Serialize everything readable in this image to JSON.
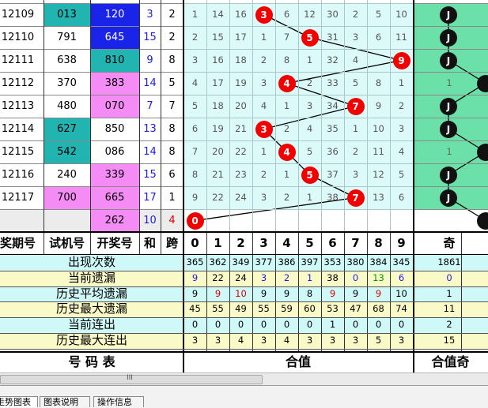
{
  "colors": {
    "period_bg": "#ffffff",
    "trial_teal": "#22b4b0",
    "trial_magenta": "#f58cf5",
    "draw_blue": "#1a24e8",
    "draw_teal": "#22b4b0",
    "draw_magenta": "#f58cf5",
    "chart_bg": "#ddfafa",
    "green_band": "#6be0a8",
    "pending_bg": "#ececec",
    "ball_red": "#f20000",
    "stat_cyan": "#cff8f8",
    "stat_yellow": "#fafac8",
    "stat_blue_text": "#1e1edc",
    "stat_red_text": "#e00000",
    "stat_green_text": "#009900"
  },
  "rows": [
    {
      "period": "12109",
      "trial": "013",
      "trial_color": "teal",
      "draw": "120",
      "draw_color": "blue",
      "sum": "3",
      "span": "2",
      "miss": [
        "1",
        "14",
        "16",
        "",
        "6",
        "12",
        "30",
        "2",
        "5",
        "10"
      ],
      "ball": 3,
      "odd": "J"
    },
    {
      "period": "12110",
      "trial": "791",
      "trial_color": "",
      "draw": "645",
      "draw_color": "blue",
      "sum": "15",
      "span": "2",
      "miss": [
        "2",
        "15",
        "17",
        "1",
        "7",
        "",
        "31",
        "3",
        "6",
        "11"
      ],
      "ball": 5,
      "odd": "J"
    },
    {
      "period": "12111",
      "trial": "638",
      "trial_color": "",
      "draw": "810",
      "draw_color": "teal",
      "sum": "9",
      "span": "8",
      "miss": [
        "3",
        "16",
        "18",
        "2",
        "8",
        "1",
        "32",
        "4",
        "",
        "12"
      ],
      "ball": 9,
      "odd": "J"
    },
    {
      "period": "12112",
      "trial": "370",
      "trial_color": "",
      "draw": "383",
      "draw_color": "magenta",
      "sum": "14",
      "span": "5",
      "miss": [
        "4",
        "17",
        "19",
        "3",
        "",
        "2",
        "33",
        "5",
        "8",
        "1"
      ],
      "ball": 4,
      "odd": "1"
    },
    {
      "period": "12113",
      "trial": "480",
      "trial_color": "",
      "draw": "070",
      "draw_color": "magenta",
      "sum": "7",
      "span": "7",
      "miss": [
        "5",
        "18",
        "20",
        "4",
        "1",
        "3",
        "34",
        "",
        "9",
        "2"
      ],
      "ball": 7,
      "odd": "J"
    },
    {
      "period": "12114",
      "trial": "627",
      "trial_color": "teal",
      "draw": "850",
      "draw_color": "",
      "sum": "13",
      "span": "8",
      "miss": [
        "6",
        "19",
        "21",
        "",
        "2",
        "4",
        "35",
        "1",
        "10",
        "3"
      ],
      "ball": 3,
      "odd": "J"
    },
    {
      "period": "12115",
      "trial": "542",
      "trial_color": "teal",
      "draw": "086",
      "draw_color": "",
      "sum": "14",
      "span": "8",
      "miss": [
        "7",
        "20",
        "22",
        "1",
        "",
        "5",
        "36",
        "2",
        "11",
        "4"
      ],
      "ball": 4,
      "odd": "1"
    },
    {
      "period": "12116",
      "trial": "240",
      "trial_color": "",
      "draw": "339",
      "draw_color": "magenta",
      "sum": "15",
      "span": "6",
      "miss": [
        "8",
        "21",
        "23",
        "2",
        "1",
        "",
        "37",
        "3",
        "12",
        "5"
      ],
      "ball": 5,
      "odd": "J"
    },
    {
      "period": "12117",
      "trial": "700",
      "trial_color": "magenta",
      "draw": "665",
      "draw_color": "magenta",
      "sum": "17",
      "span": "1",
      "miss": [
        "9",
        "22",
        "24",
        "3",
        "2",
        "1",
        "38",
        "",
        "13",
        "6"
      ],
      "ball": 7,
      "odd": "J"
    },
    {
      "period": "",
      "trial": "",
      "trial_color": "",
      "draw": "262",
      "draw_color": "magenta",
      "sum": "10",
      "span": "4",
      "miss": [
        "",
        "",
        "",
        "",
        "",
        "",
        "",
        "",
        "",
        ""
      ],
      "ball": 0,
      "odd": ""
    }
  ],
  "headers": {
    "period": "奖期号",
    "trial": "试机号",
    "draw": "开奖号",
    "sum": "和",
    "span": "跨",
    "digits": [
      "0",
      "1",
      "2",
      "3",
      "4",
      "5",
      "6",
      "7",
      "8",
      "9"
    ],
    "odd": "奇"
  },
  "stats": [
    {
      "label": "出现次数",
      "values": [
        "365",
        "362",
        "349",
        "377",
        "386",
        "397",
        "353",
        "380",
        "384",
        "345"
      ],
      "extra": "1861",
      "kind": "count"
    },
    {
      "label": "当前遗漏",
      "values": [
        "9",
        "22",
        "24",
        "3",
        "2",
        "1",
        "38",
        "0",
        "13",
        "6"
      ],
      "extra": "0",
      "kind": "current"
    },
    {
      "label": "历史平均遗漏",
      "values": [
        "9",
        "9",
        "10",
        "9",
        "9",
        "8",
        "9",
        "9",
        "9",
        "10"
      ],
      "extra": "1",
      "kind": "avg"
    },
    {
      "label": "历史最大遗漏",
      "values": [
        "45",
        "55",
        "49",
        "55",
        "59",
        "60",
        "53",
        "47",
        "68",
        "74"
      ],
      "extra": "11",
      "kind": "max"
    },
    {
      "label": "当前连出",
      "values": [
        "0",
        "0",
        "0",
        "0",
        "0",
        "0",
        "1",
        "0",
        "0",
        "0"
      ],
      "extra": "2",
      "kind": "streak"
    },
    {
      "label": "历史最大连出",
      "values": [
        "3",
        "3",
        "4",
        "3",
        "4",
        "3",
        "3",
        "3",
        "5",
        "3"
      ],
      "extra": "15",
      "kind": "maxstreak"
    }
  ],
  "footer": {
    "left": "号  码  表",
    "middle": "合值",
    "right": "合值奇"
  },
  "scrollbar_grip": "III",
  "tabs": [
    "走势图表",
    "图表说明",
    "操作信息"
  ]
}
